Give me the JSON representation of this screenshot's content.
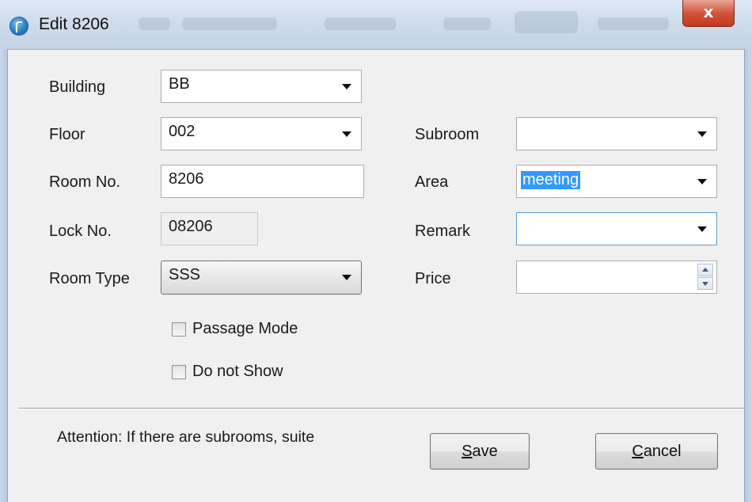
{
  "window": {
    "title": "Edit 8206",
    "close_glyph": "x",
    "app_icon": "app-logo-icon"
  },
  "form": {
    "building": {
      "label": "Building",
      "value": "BB"
    },
    "floor": {
      "label": "Floor",
      "value": "002"
    },
    "room_no": {
      "label": "Room No.",
      "value": "8206"
    },
    "lock_no": {
      "label": "Lock No.",
      "value": "08206"
    },
    "room_type": {
      "label": "Room Type",
      "value": "SSS"
    },
    "subroom": {
      "label": "Subroom",
      "value": ""
    },
    "area": {
      "label": "Area",
      "value": "meeting"
    },
    "remark": {
      "label": "Remark",
      "value": ""
    },
    "price": {
      "label": "Price",
      "value": ""
    }
  },
  "checkboxes": {
    "passage_mode": {
      "label": "Passage Mode",
      "checked": false
    },
    "do_not_show": {
      "label": "Do not Show",
      "checked": false
    }
  },
  "footer": {
    "attention": "Attention: If there are subrooms, suite",
    "save": {
      "mnemonic": "S",
      "rest": "ave"
    },
    "cancel": {
      "mnemonic": "C",
      "rest": "ancel"
    }
  },
  "colors": {
    "selection": "#3399ff",
    "close_button": "#c0391f",
    "titlebar": "#cfdceb"
  }
}
